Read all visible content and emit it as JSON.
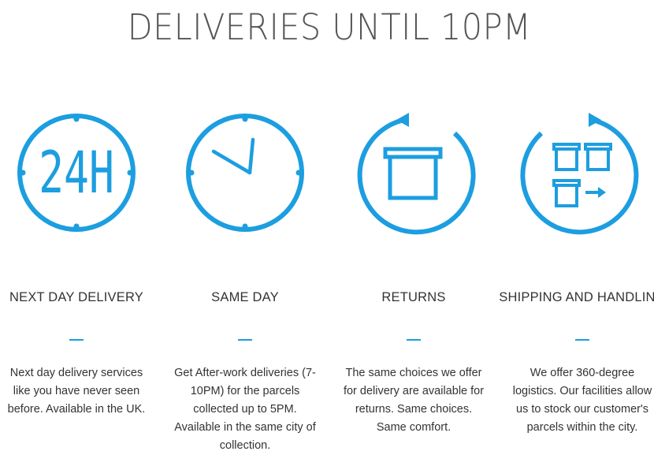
{
  "title": "DELIVERIES UNTIL 10PM",
  "colors": {
    "accent": "#1c9ee0",
    "text": "#333333",
    "title": "#555555"
  },
  "features": [
    {
      "icon": "24h-clock-icon",
      "icon_text": "24H",
      "heading": "NEXT DAY DELIVERY",
      "description": "Next day delivery services like you have never seen before. Available in the UK."
    },
    {
      "icon": "clock-icon",
      "heading": "SAME DAY",
      "description": "Get After-work deliveries (7-10PM) for the parcels collected up to 5PM. Available in the same city of collection."
    },
    {
      "icon": "return-box-icon",
      "heading": "RETURNS",
      "description": "The same choices we offer for delivery are available for returns. Same choices. Same comfort."
    },
    {
      "icon": "shipping-boxes-icon",
      "heading": "SHIPPING AND HANDLING",
      "description": "We offer 360-degree logistics. Our facilities allow us to stock our customer's parcels within the city."
    }
  ]
}
